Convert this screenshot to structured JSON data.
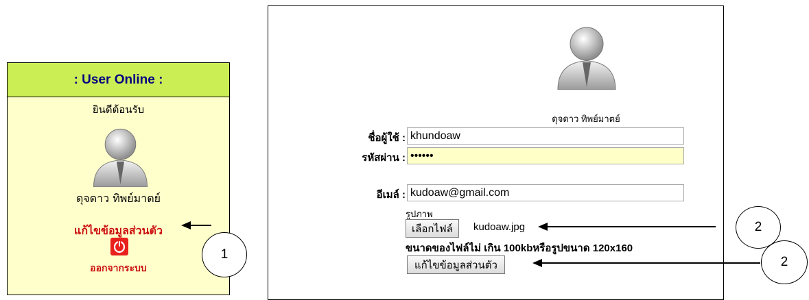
{
  "user_online": {
    "header": ": User Online :",
    "welcome": "ยินดีต้อนรับ",
    "name": "ดุจดาว ทิพย์มาตย์",
    "edit_link": "แก้ไขข้อมูลส่วนตัว",
    "logout_link": "ออกจากระบบ"
  },
  "profile_form": {
    "name": "ดุจดาว ทิพย์มาตย์",
    "username_label": "ชื่อผู้ใช้ :",
    "username_value": "khundoaw",
    "password_label": "รหัสผ่าน :",
    "password_value": "••••••",
    "email_label": "อีเมล์ :",
    "email_value": "kudoaw@gmail.com",
    "picture_label": "รูปภาพ",
    "choose_file_label": "เลือกไฟล์",
    "file_name": "kudoaw.jpg",
    "file_note": "ขนาดของไฟล์ไม่ เกิน 100kbหรือรูปขนาด 120x160",
    "submit_label": "แก้ไขข้อมูลส่วนตัว"
  },
  "callouts": [
    "1",
    "2",
    "2"
  ],
  "icons": {
    "avatar": "user-avatar-icon",
    "logout": "power-icon"
  },
  "colors": {
    "panel_bg": "#ffffcc",
    "header_bg": "#ccee55",
    "header_text": "#000080",
    "link_red": "#cc1111",
    "password_bg": "#ffffc8"
  }
}
